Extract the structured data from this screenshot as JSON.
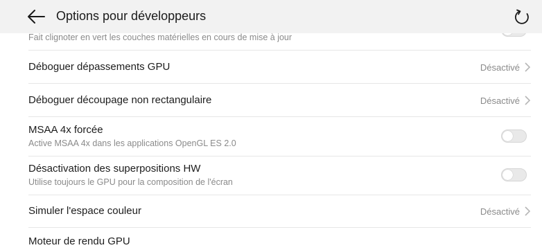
{
  "header": {
    "title": "Options pour développeurs",
    "back_icon": "arrow-left-icon",
    "reset_icon": "refresh-icon"
  },
  "rows": [
    {
      "subtitle": "Fait clignoter en vert les couches matérielles en cours de mise à jour",
      "control": "toggle",
      "checked": false
    },
    {
      "title": "Déboguer dépassements GPU",
      "value": "Désactivé",
      "control": "chevron"
    },
    {
      "title": "Déboguer découpage non rectangulaire",
      "value": "Désactivé",
      "control": "chevron"
    },
    {
      "title": "MSAA 4x forcée",
      "subtitle": "Active MSAA 4x dans les applications OpenGL ES 2.0",
      "control": "toggle",
      "checked": false
    },
    {
      "title": "Désactivation des superpositions HW",
      "subtitle": "Utilise toujours le GPU pour la composition de l'écran",
      "control": "toggle",
      "checked": false
    },
    {
      "title": "Simuler l'espace couleur",
      "value": "Désactivé",
      "control": "chevron"
    },
    {
      "title": "Moteur de rendu GPU"
    }
  ],
  "colors": {
    "header_bg": "#f2f2f2",
    "divider": "#e6e6e6",
    "secondary_text": "#8a8a8a",
    "toggle_off": "#e9e9e9"
  }
}
